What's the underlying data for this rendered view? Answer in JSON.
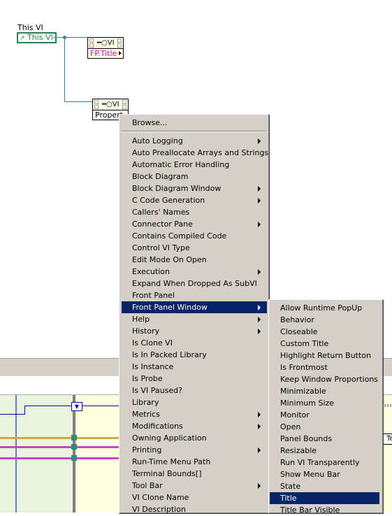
{
  "diagram": {
    "this_vi_caption": "This VI",
    "this_vi_terminal": "This VI",
    "node1": {
      "class_label": "VI",
      "property": "FP.Title"
    },
    "node2": {
      "class_label": "VI",
      "property_stub": "Propert"
    },
    "partial_label_right": "I Te"
  },
  "context_menu": {
    "browse": "Browse...",
    "items": [
      {
        "label": "Auto Logging",
        "submenu": true
      },
      {
        "label": "Auto Preallocate Arrays and Strings",
        "submenu": false
      },
      {
        "label": "Automatic Error Handling",
        "submenu": false
      },
      {
        "label": "Block Diagram",
        "submenu": false
      },
      {
        "label": "Block Diagram Window",
        "submenu": true
      },
      {
        "label": "C Code Generation",
        "submenu": true
      },
      {
        "label": "Callers' Names",
        "submenu": false
      },
      {
        "label": "Connector Pane",
        "submenu": true
      },
      {
        "label": "Contains Compiled Code",
        "submenu": false
      },
      {
        "label": "Control VI Type",
        "submenu": false
      },
      {
        "label": "Edit Mode On Open",
        "submenu": false
      },
      {
        "label": "Execution",
        "submenu": true
      },
      {
        "label": "Expand When Dropped As SubVI",
        "submenu": false
      },
      {
        "label": "Front Panel",
        "submenu": false
      },
      {
        "label": "Front Panel Window",
        "submenu": true,
        "selected": true
      },
      {
        "label": "Help",
        "submenu": true
      },
      {
        "label": "History",
        "submenu": true
      },
      {
        "label": "Is Clone VI",
        "submenu": false
      },
      {
        "label": "Is In Packed Library",
        "submenu": false
      },
      {
        "label": "Is Instance",
        "submenu": false
      },
      {
        "label": "Is Probe",
        "submenu": false
      },
      {
        "label": "Is VI Paused?",
        "submenu": false
      },
      {
        "label": "Library",
        "submenu": false
      },
      {
        "label": "Metrics",
        "submenu": true
      },
      {
        "label": "Modifications",
        "submenu": true
      },
      {
        "label": "Owning Application",
        "submenu": false
      },
      {
        "label": "Printing",
        "submenu": true
      },
      {
        "label": "Run-Time Menu Path",
        "submenu": false
      },
      {
        "label": "Terminal Bounds[]",
        "submenu": false
      },
      {
        "label": "Tool Bar",
        "submenu": true
      },
      {
        "label": "VI Clone Name",
        "submenu": false
      },
      {
        "label": "VI Description",
        "submenu": false
      }
    ]
  },
  "submenu": {
    "items": [
      {
        "label": "Allow Runtime PopUp"
      },
      {
        "label": "Behavior"
      },
      {
        "label": "Closeable"
      },
      {
        "label": "Custom Title"
      },
      {
        "label": "Highlight Return Button"
      },
      {
        "label": "Is Frontmost"
      },
      {
        "label": "Keep Window Proportions"
      },
      {
        "label": "Minimizable"
      },
      {
        "label": "Minimum Size"
      },
      {
        "label": "Monitor"
      },
      {
        "label": "Open"
      },
      {
        "label": "Panel Bounds"
      },
      {
        "label": "Resizable"
      },
      {
        "label": "Run VI Transparently"
      },
      {
        "label": "Show Menu Bar"
      },
      {
        "label": "State"
      },
      {
        "label": "Title",
        "selected": true
      },
      {
        "label": "Title Bar Visible"
      }
    ]
  },
  "colors": {
    "menu_bg": "#d4d0c8",
    "selection": "#0a246a",
    "ref_wire": "#2e8b8b",
    "ref_terminal": "#2e7d54",
    "string_text": "#cc00cc"
  }
}
